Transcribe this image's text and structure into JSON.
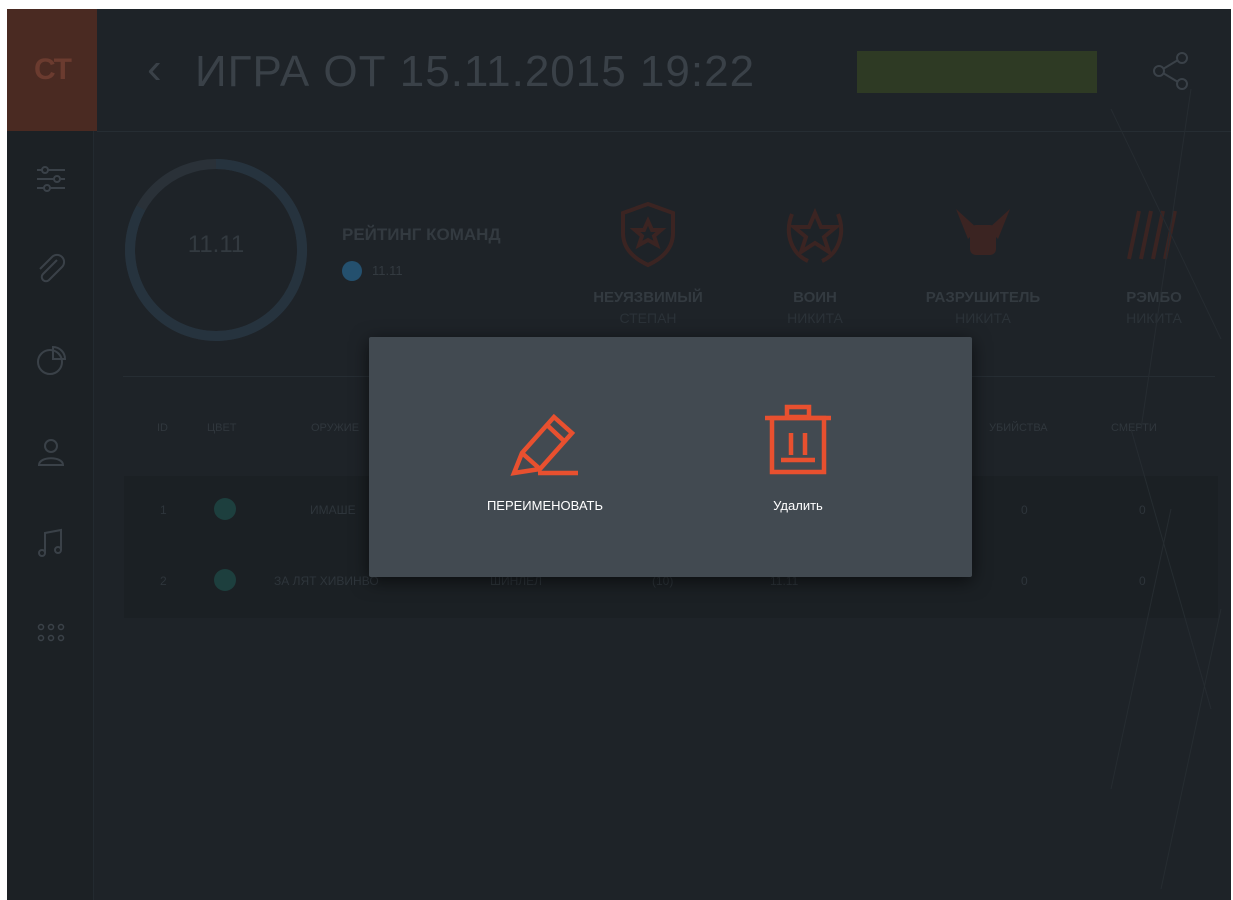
{
  "app": {
    "logo_text": "CT",
    "title": "ИГРА ОТ 15.11.2015 19:22",
    "header_button": "",
    "accent_color": "#e8502f"
  },
  "sidebar": {
    "items": [
      {
        "icon": "sliders-icon"
      },
      {
        "icon": "paperclip-icon"
      },
      {
        "icon": "pie-chart-icon"
      },
      {
        "icon": "user-icon"
      },
      {
        "icon": "music-icon"
      },
      {
        "icon": "grid-dots-icon"
      }
    ]
  },
  "stats": {
    "ring_value": "11.11",
    "rating_title": "РЕЙТИНГ КОМАНД",
    "rating_value": "11.11",
    "awards": [
      {
        "name": "НЕУЯЗВИМЫЙ",
        "player": "СТЕПАН",
        "icon": "shield-star-icon"
      },
      {
        "name": "ВОИН",
        "player": "НИКИТА",
        "icon": "wreath-star-icon"
      },
      {
        "name": "РАЗРУШИТЕЛЬ",
        "player": "НИКИТА",
        "icon": "fist-icon"
      },
      {
        "name": "РЭМБО",
        "player": "НИКИТА",
        "icon": "bullets-icon"
      }
    ]
  },
  "table": {
    "headers": {
      "id": "ID",
      "color": "ЦВЕТ",
      "weapon": "ОРУЖИЕ",
      "kills": "УБИЙСТВА",
      "deaths": "СМЕРТИ"
    },
    "rows": [
      {
        "id": "1",
        "weapon": "ИМАШЕ",
        "col3": "",
        "col4": "",
        "col5": "",
        "kills": "0",
        "deaths": "0"
      },
      {
        "id": "2",
        "weapon": "ЗА ЛЯТ ХИВИНВО",
        "col3": "ШИНЛЕЛ",
        "col4": "(10)",
        "col5": "11.11",
        "kills": "0",
        "deaths": "0"
      }
    ]
  },
  "dialog": {
    "rename_label": "ПЕРЕИМЕНОВАТЬ",
    "delete_label": "Удалить"
  }
}
